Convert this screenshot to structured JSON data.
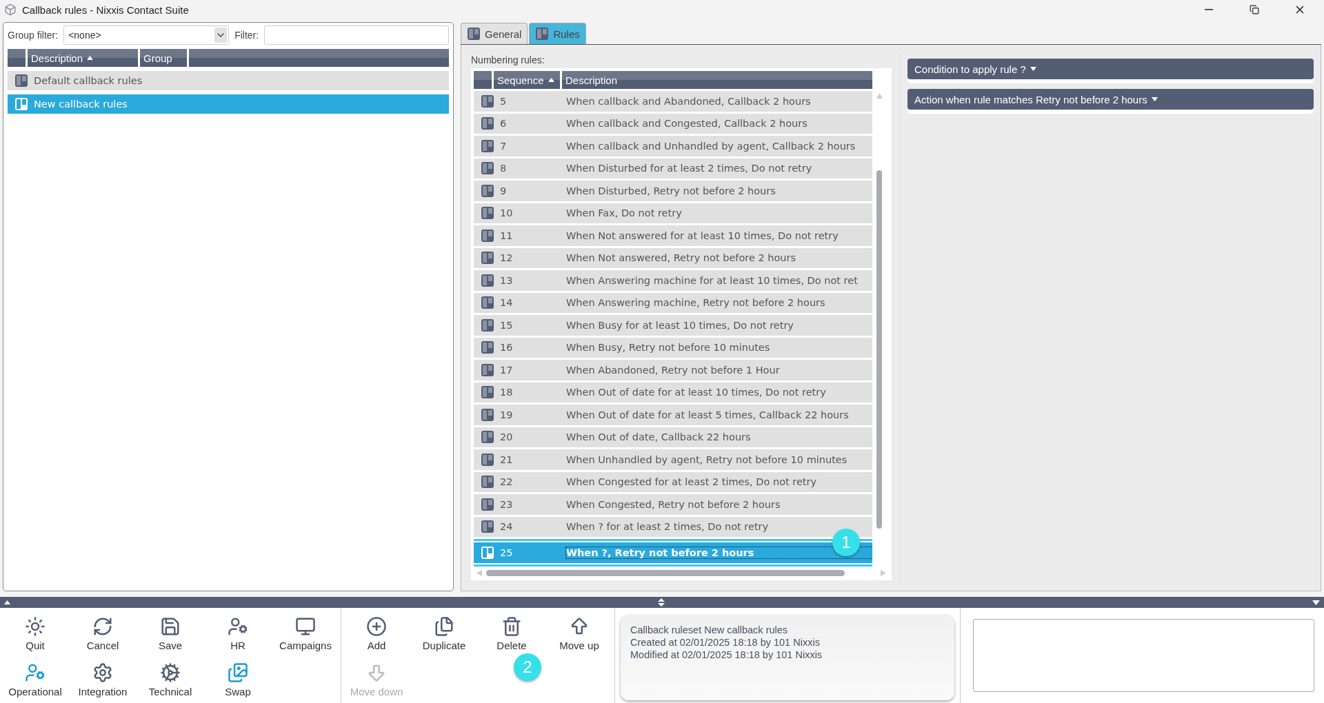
{
  "window": {
    "title": "Callback rules - Nixxis Contact Suite"
  },
  "left_panel": {
    "group_filter": {
      "label": "Group filter:",
      "value": "<none>"
    },
    "filter": {
      "label": "Filter:"
    },
    "columns": [
      {
        "label": "Description",
        "sorted": true
      },
      {
        "label": "Group",
        "sorted": false
      }
    ],
    "rows": [
      {
        "description": "Default callback rules",
        "selected": false
      },
      {
        "description": "New callback rules",
        "selected": true
      }
    ]
  },
  "tabs": [
    {
      "label": "General",
      "selected": false
    },
    {
      "label": "Rules",
      "selected": true
    }
  ],
  "rules": {
    "label": "Numbering rules:",
    "columns": [
      {
        "label": "Sequence",
        "sorted": true
      },
      {
        "label": "Description",
        "sorted": false
      }
    ],
    "rows": [
      {
        "sequence": "5",
        "description": "When callback and Abandoned, Callback 2 hours",
        "selected": false
      },
      {
        "sequence": "6",
        "description": "When callback and Congested, Callback 2 hours",
        "selected": false
      },
      {
        "sequence": "7",
        "description": "When callback and Unhandled by agent, Callback 2 hours",
        "selected": false
      },
      {
        "sequence": "8",
        "description": "When Disturbed for at least 2 times, Do not retry",
        "selected": false
      },
      {
        "sequence": "9",
        "description": "When Disturbed, Retry not before 2 hours",
        "selected": false
      },
      {
        "sequence": "10",
        "description": "When Fax, Do not retry",
        "selected": false
      },
      {
        "sequence": "11",
        "description": "When Not answered for at least 10 times, Do not retry",
        "selected": false
      },
      {
        "sequence": "12",
        "description": "When Not answered, Retry not before 2 hours",
        "selected": false
      },
      {
        "sequence": "13",
        "description": "When Answering machine for at least 10 times, Do not ret",
        "selected": false
      },
      {
        "sequence": "14",
        "description": "When Answering machine, Retry not before 2 hours",
        "selected": false
      },
      {
        "sequence": "15",
        "description": "When Busy for at least 10 times, Do not retry",
        "selected": false
      },
      {
        "sequence": "16",
        "description": "When Busy, Retry not before 10 minutes",
        "selected": false
      },
      {
        "sequence": "17",
        "description": "When Abandoned, Retry not before 1 Hour",
        "selected": false
      },
      {
        "sequence": "18",
        "description": "When Out of date for at least 10 times, Do not retry",
        "selected": false
      },
      {
        "sequence": "19",
        "description": "When Out of date for at least 5 times, Callback 22 hours",
        "selected": false
      },
      {
        "sequence": "20",
        "description": "When Out of date, Callback 22 hours",
        "selected": false
      },
      {
        "sequence": "21",
        "description": "When Unhandled by agent, Retry not before 10 minutes",
        "selected": false
      },
      {
        "sequence": "22",
        "description": "When Congested for at least 2 times, Do not retry",
        "selected": false
      },
      {
        "sequence": "23",
        "description": "When Congested, Retry not before 2 hours",
        "selected": false
      },
      {
        "sequence": "24",
        "description": "When ? for at least 2 times, Do not retry",
        "selected": false
      },
      {
        "sequence": "25",
        "description": "When ?, Retry not before 2 hours",
        "selected": true
      }
    ]
  },
  "sections": [
    {
      "label": "Condition to apply rule",
      "value": "?"
    },
    {
      "label": "Action when rule matches",
      "value": "Retry not before 2 hours"
    }
  ],
  "toolbar": {
    "groups": [
      [
        {
          "label": "Quit",
          "disabled": false
        },
        {
          "label": "Cancel",
          "disabled": false
        },
        {
          "label": "Save",
          "disabled": false
        },
        {
          "label": "HR",
          "disabled": false
        },
        {
          "label": "Campaigns",
          "disabled": false
        },
        {
          "label": "Operational",
          "disabled": false
        },
        {
          "label": "Integration",
          "disabled": false
        },
        {
          "label": "Technical",
          "disabled": false
        },
        {
          "label": "Swap",
          "disabled": false
        }
      ],
      [
        {
          "label": "Add",
          "disabled": false
        },
        {
          "label": "Duplicate",
          "disabled": false
        },
        {
          "label": "Delete",
          "disabled": false
        },
        {
          "label": "Move up",
          "disabled": false
        },
        {
          "label": "Move down",
          "disabled": true
        }
      ]
    ]
  },
  "info": [
    "Callback ruleset New callback rules",
    "Created at 02/01/2025 18:18 by 101 Nixxis",
    "Modified at 02/01/2025 18:18 by 101 Nixxis"
  ],
  "markers": [
    "1",
    "2"
  ]
}
